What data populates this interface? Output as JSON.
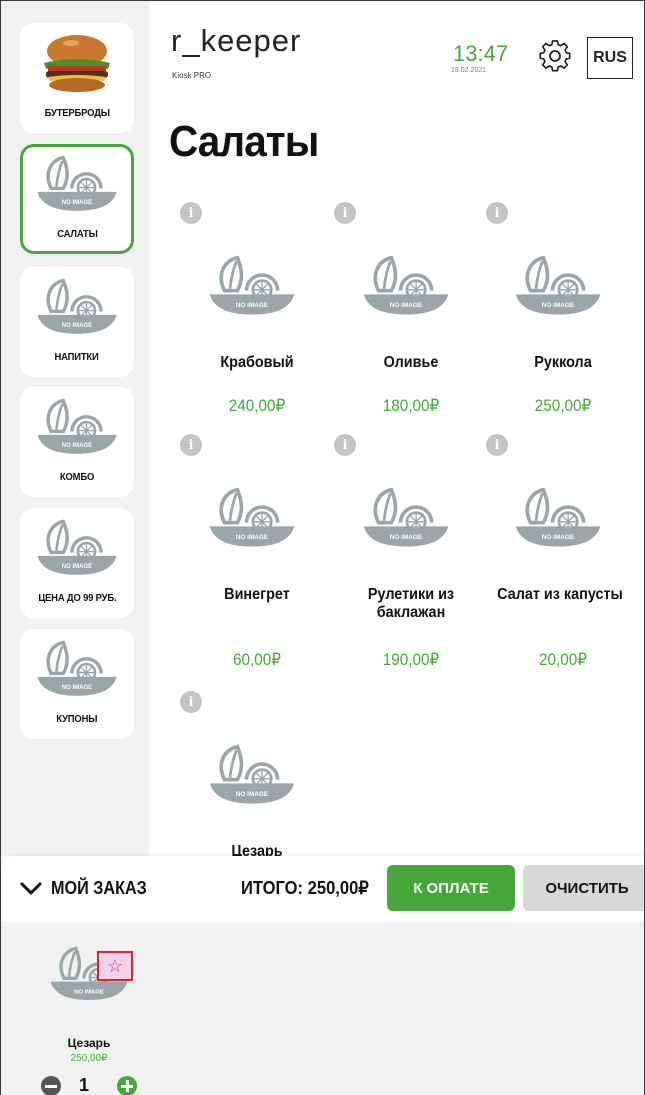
{
  "header": {
    "brand": "r_keeper",
    "brand_sub": "Kiosk PRO",
    "time": "13:47",
    "date": "18.02.2021",
    "language": "RUS"
  },
  "no_image_label": "NO IMAGE",
  "sidebar": {
    "items": [
      {
        "label": "БУТЕРБРОДЫ",
        "image": "burger-photo",
        "active": false
      },
      {
        "label": "САЛАТЫ",
        "image": "no-image",
        "active": true
      },
      {
        "label": "НАПИТКИ",
        "image": "no-image",
        "active": false
      },
      {
        "label": "КОМБО",
        "image": "no-image",
        "active": false
      },
      {
        "label": "ЦЕНА ДО 99 РУБ.",
        "image": "no-image",
        "active": false
      },
      {
        "label": "КУПОНЫ",
        "image": "no-image",
        "active": false
      }
    ]
  },
  "main": {
    "title": "Салаты",
    "info_glyph": "i",
    "products": [
      {
        "name": "Крабовый",
        "price": "240,00₽"
      },
      {
        "name": "Оливье",
        "price": "180,00₽"
      },
      {
        "name": "Руккола",
        "price": "250,00₽"
      },
      {
        "name": "Винегрет",
        "price": "60,00₽"
      },
      {
        "name": "Рулетики из баклажан",
        "price": "190,00₽"
      },
      {
        "name": "Салат из капусты",
        "price": "20,00₽"
      },
      {
        "name": "Цезарь",
        "price": ""
      }
    ]
  },
  "order_bar": {
    "my_order": "МОЙ ЗАКАЗ",
    "total": "ИТОГО: 250,00₽",
    "pay": "К ОПЛАТЕ",
    "clear": "ОЧИСТИТЬ"
  },
  "basket": {
    "items": [
      {
        "name": "Цезарь",
        "price": "250,00₽",
        "quantity": "1",
        "favorite_glyph": "☆"
      }
    ]
  },
  "colors": {
    "accent": "#46a83a",
    "sidebar_bg": "#f1f1f1",
    "placeholder": "#9aa5a8",
    "favorite_outline": "#e0222b"
  }
}
